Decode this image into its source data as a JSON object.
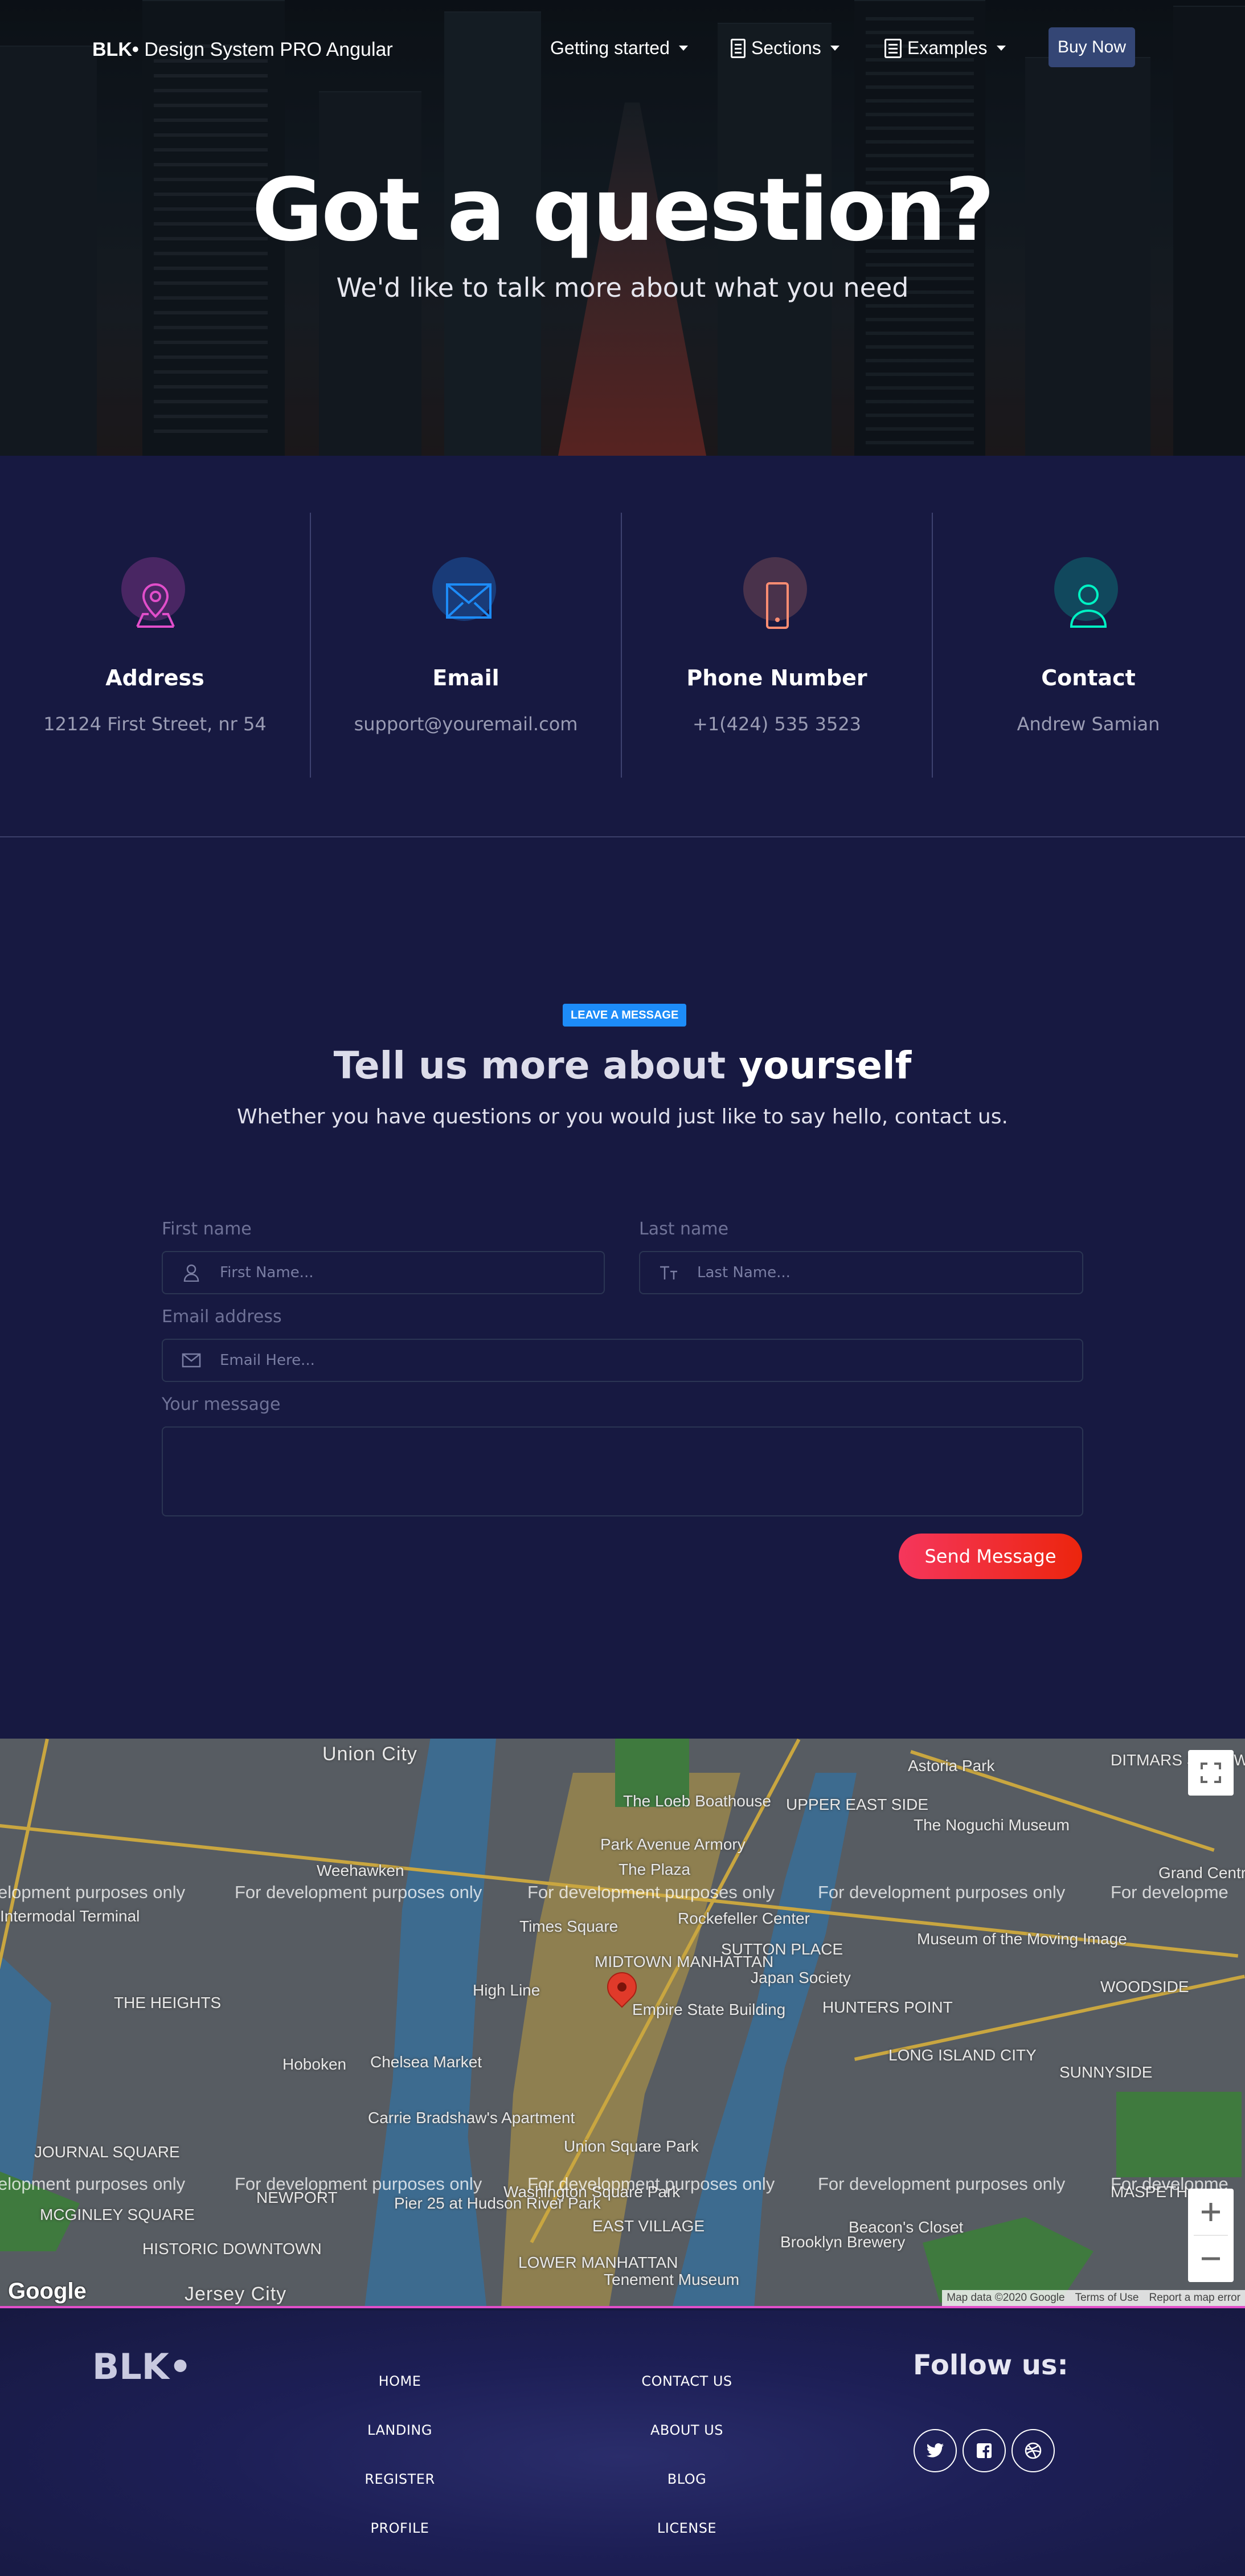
{
  "nav": {
    "brand_bold": "BLK•",
    "brand_rest": " Design System PRO Angular",
    "items": [
      {
        "label": "Getting started",
        "icon": "none"
      },
      {
        "label": "Sections",
        "icon": "document-icon"
      },
      {
        "label": "Examples",
        "icon": "book-icon"
      }
    ],
    "buy_label": "Buy Now"
  },
  "hero": {
    "title": "Got a question?",
    "subtitle": "We'd like to talk more about what you need"
  },
  "info": [
    {
      "title": "Address",
      "value": "12124 First Street, nr 54",
      "icon": "pin-icon",
      "color": "#e14eca"
    },
    {
      "title": "Email",
      "value": "support@youremail.com",
      "icon": "mail-icon",
      "color": "#1d8cf8"
    },
    {
      "title": "Phone Number",
      "value": "+1(424) 535 3523",
      "icon": "phone-icon",
      "color": "#ff8d72"
    },
    {
      "title": "Contact",
      "value": "Andrew Samian",
      "icon": "user-icon",
      "color": "#00f2c3"
    }
  ],
  "form": {
    "badge": "LEAVE A MESSAGE",
    "title_light": "Tell us more about ",
    "title_bold": "yourself",
    "subtitle": "Whether you have questions or you would just like to say hello, contact us.",
    "first_name_label": "First name",
    "first_name_placeholder": "First Name...",
    "last_name_label": "Last name",
    "last_name_placeholder": "Last Name...",
    "email_label": "Email address",
    "email_placeholder": "Email Here...",
    "message_label": "Your message",
    "send_label": "Send Message"
  },
  "map": {
    "dev_text": "For development purposes only",
    "dev_text_cut": "elopment purposes only",
    "dev_text_cut_right": "For developme",
    "labels": [
      "Union City",
      "Weehawken",
      "Hoboken",
      "Jersey City",
      "THE HEIGHTS",
      "JOURNAL SQUARE",
      "MCGINLEY SQUARE",
      "HISTORIC DOWNTOWN",
      "NEWPORT",
      "MIDTOWN MANHATTAN",
      "Times Square",
      "Rockefeller Center",
      "SUTTON PLACE",
      "Japan Society",
      "Empire State Building",
      "Chelsea Market",
      "High Line",
      "Union Square Park",
      "Washington Square Park",
      "EAST VILLAGE",
      "LOWER MANHATTAN",
      "Tenement Museum",
      "Brooklyn Brewery",
      "Beacon's Closet",
      "HUNTERS POINT",
      "LONG ISLAND CITY",
      "SUNNYSIDE",
      "WOODSIDE",
      "Astoria Park",
      "DITMARS STEINWAY",
      "The Noguchi Museum",
      "Museum of the Moving Image",
      "UPPER EAST SIDE",
      "Park Avenue Armory",
      "The Loeb Boathouse",
      "The Plaza",
      "Carrie Bradshaw's Apartment",
      "Pier 25 at Hudson River Park",
      "MASPETH",
      "Grand Central P",
      "Intermodal Terminal"
    ],
    "google": "Google",
    "attribution": [
      "Map data ©2020 Google",
      "Terms of Use",
      "Report a map error"
    ]
  },
  "footer": {
    "brand": "BLK•",
    "col1": [
      "HOME",
      "LANDING",
      "REGISTER",
      "PROFILE"
    ],
    "col2": [
      "CONTACT US",
      "ABOUT US",
      "BLOG",
      "LICENSE"
    ],
    "follow": "Follow us:",
    "social": [
      "twitter-icon",
      "facebook-icon",
      "dribbble-icon"
    ]
  }
}
